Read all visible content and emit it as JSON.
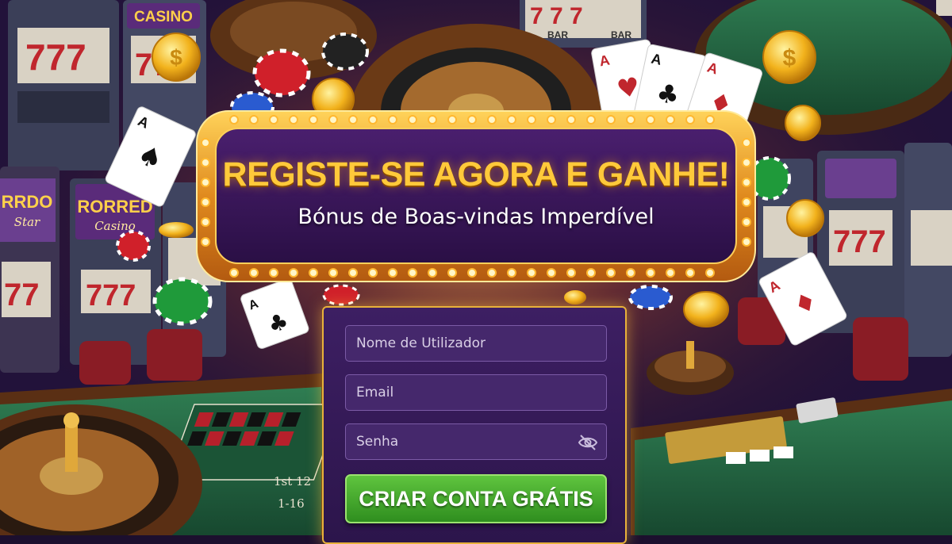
{
  "promo": {
    "headline": "REGISTE-SE AGORA E GANHE!",
    "subheadline": "Bónus de Boas-vindas Imperdível"
  },
  "background": {
    "slot_sign_left": "CASINO",
    "slot_sign_mid": "RORRED",
    "slot_sign_mid_sub": "Casino",
    "slot_sign_far_left": "RRDO",
    "slot_sign_far_left_sub": "Star",
    "reel_symbol": "7",
    "reel_bar": "BAR",
    "table_labels": [
      "1st 12",
      "1-16"
    ],
    "card_rank": "A"
  },
  "signup_form": {
    "username": {
      "placeholder": "Nome de Utilizador",
      "value": ""
    },
    "email": {
      "placeholder": "Email",
      "value": ""
    },
    "password": {
      "placeholder": "Senha",
      "value": "",
      "toggle_icon": "eye-off-icon"
    },
    "submit_label": "CRIAR CONTA GRÁTIS"
  },
  "colors": {
    "headline": "#ffc93a",
    "frame_gold": "#e8b13a",
    "button_green": "#4caf32",
    "panel_purple": "#3d1f63"
  }
}
